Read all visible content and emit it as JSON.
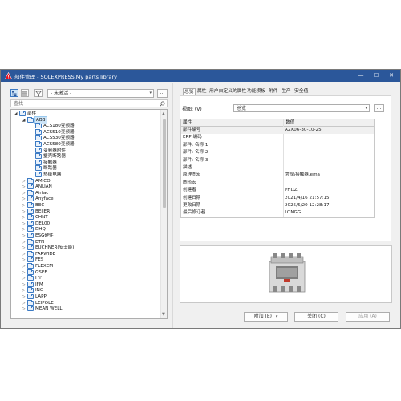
{
  "window": {
    "title": "部件管理 - SQLEXPRESS.My parts library",
    "accent": "#2b579a"
  },
  "titlebar_controls": [
    "—",
    "☐",
    "✕"
  ],
  "left_toolbar": {
    "view_button1_icon": "tree-view-icon",
    "view_button2_icon": "list-view-icon",
    "filter_icon": "filter-icon",
    "filter_value": "- 未激活 -",
    "more_button_label": "..."
  },
  "search": {
    "placeholder": "查找",
    "icon": "search-icon"
  },
  "tree": {
    "root_label": "部件",
    "items": [
      {
        "label": "ABB",
        "level": 2,
        "expanded": true,
        "selected": true
      },
      {
        "label": "ACS180变频器",
        "level": 3
      },
      {
        "label": "ACS510变频器",
        "level": 3
      },
      {
        "label": "ACS530变频器",
        "level": 3
      },
      {
        "label": "ACS580变频器",
        "level": 3
      },
      {
        "label": "变频器附件",
        "level": 3
      },
      {
        "label": "塑壳断路器",
        "level": 3
      },
      {
        "label": "接触器",
        "level": 3
      },
      {
        "label": "断路器",
        "level": 3
      },
      {
        "label": "热继电器",
        "level": 3
      },
      {
        "label": "AMICO",
        "level": 2
      },
      {
        "label": "ANLIAN",
        "level": 2
      },
      {
        "label": "Airtac",
        "level": 2
      },
      {
        "label": "Anyface",
        "level": 2
      },
      {
        "label": "BEC",
        "level": 2
      },
      {
        "label": "BEIJER",
        "level": 2
      },
      {
        "label": "CHNT",
        "level": 2
      },
      {
        "label": "DEL00",
        "level": 2
      },
      {
        "label": "DHQ",
        "level": 2
      },
      {
        "label": "ESG硬件",
        "level": 2
      },
      {
        "label": "ETN",
        "level": 2
      },
      {
        "label": "EUCHNER(安士能)",
        "level": 2
      },
      {
        "label": "FARWIDE",
        "level": 2
      },
      {
        "label": "FES",
        "level": 2
      },
      {
        "label": "FLEXEM",
        "level": 2
      },
      {
        "label": "GSEE",
        "level": 2
      },
      {
        "label": "HY",
        "level": 2
      },
      {
        "label": "IFM",
        "level": 2
      },
      {
        "label": "INO",
        "level": 2
      },
      {
        "label": "LAPP",
        "level": 2
      },
      {
        "label": "LEIPOLE",
        "level": 2
      },
      {
        "label": "MEAN WELL",
        "level": 2
      }
    ]
  },
  "tabs": [
    {
      "label": "总览",
      "active": true
    },
    {
      "label": "属性"
    },
    {
      "label": "用户自定义的属性"
    },
    {
      "label": "功能模板"
    },
    {
      "label": "附件"
    },
    {
      "label": "生产"
    },
    {
      "label": "安全值"
    }
  ],
  "view": {
    "label": "视图: (V)",
    "value": "总览",
    "more_button_label": "..."
  },
  "grid": {
    "headers": [
      "属性",
      "数值"
    ],
    "rows": [
      {
        "k": "部件编号",
        "v": "A2X06-30-10-25"
      },
      {
        "k": "ERP 编码",
        "v": ""
      },
      {
        "k": "部件: 名称 1",
        "v": ""
      },
      {
        "k": "部件: 名称 2",
        "v": ""
      },
      {
        "k": "部件: 名称 3",
        "v": ""
      },
      {
        "k": "描述",
        "v": ""
      },
      {
        "k": "原理图宏",
        "v": "常规\\接触器.ema"
      },
      {
        "k": "图形宏",
        "v": ""
      },
      {
        "k": "创建者",
        "v": "PHDZ"
      },
      {
        "k": "创建日期",
        "v": "2021/4/16 21:57:15"
      },
      {
        "k": "更改日期",
        "v": "2025/5/20 12:28:17"
      },
      {
        "k": "最后修订者",
        "v": "LONGG"
      }
    ]
  },
  "buttons": {
    "attach": "附加 (E)",
    "close": "关闭 (C)",
    "apply": "应用 (A)"
  }
}
